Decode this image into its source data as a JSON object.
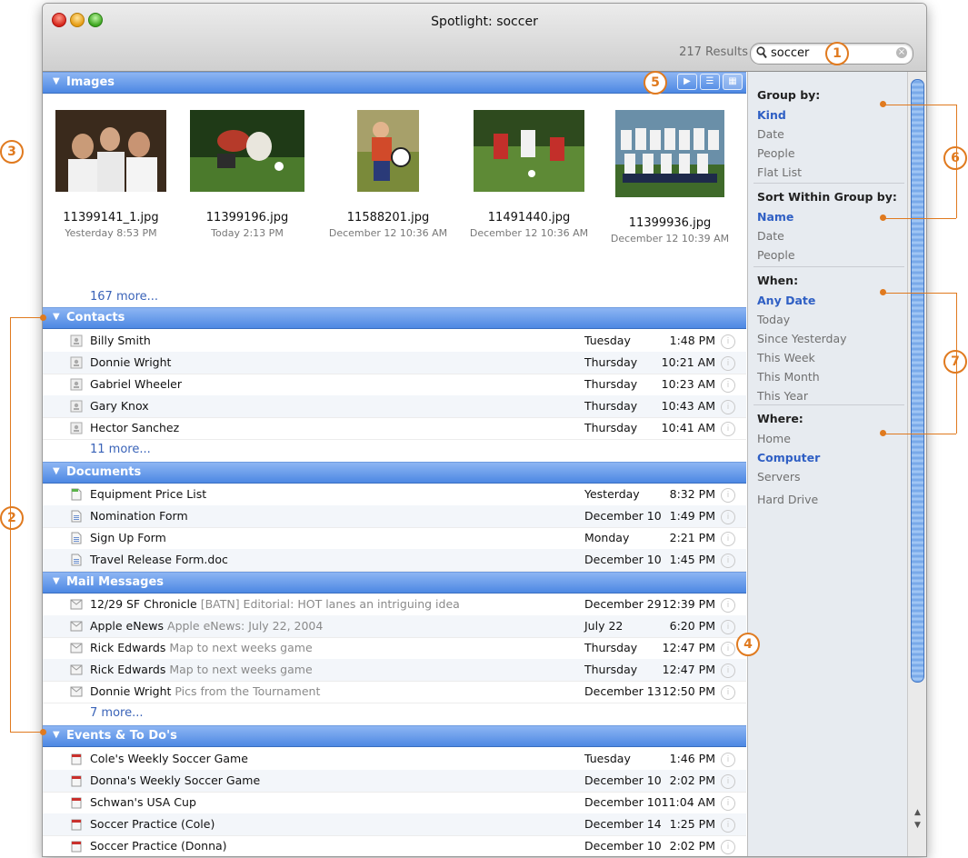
{
  "window": {
    "title": "Spotlight: soccer"
  },
  "search": {
    "results_count": "217 Results",
    "query": "soccer"
  },
  "sections": {
    "images": {
      "label": "Images",
      "items": [
        {
          "name": "11399141_1.jpg",
          "date": "Yesterday 8:53 PM"
        },
        {
          "name": "11399196.jpg",
          "date": "Today 2:13 PM"
        },
        {
          "name": "11588201.jpg",
          "date": "December 12 10:36 AM"
        },
        {
          "name": "11491440.jpg",
          "date": "December 12 10:36 AM"
        },
        {
          "name": "11399936.jpg",
          "date": "December 12 10:39 AM"
        }
      ],
      "more": "167 more..."
    },
    "contacts": {
      "label": "Contacts",
      "rows": [
        {
          "name": "Billy Smith",
          "date": "Tuesday",
          "time": "1:48 PM"
        },
        {
          "name": "Donnie Wright",
          "date": "Thursday",
          "time": "10:21 AM"
        },
        {
          "name": "Gabriel Wheeler",
          "date": "Thursday",
          "time": "10:23 AM"
        },
        {
          "name": "Gary Knox",
          "date": "Thursday",
          "time": "10:43 AM"
        },
        {
          "name": "Hector Sanchez",
          "date": "Thursday",
          "time": "10:41 AM"
        }
      ],
      "more": "11 more..."
    },
    "documents": {
      "label": "Documents",
      "rows": [
        {
          "name": "Equipment Price List",
          "date": "Yesterday",
          "time": "8:32 PM"
        },
        {
          "name": "Nomination Form",
          "date": "December 10",
          "time": "1:49 PM"
        },
        {
          "name": "Sign Up Form",
          "date": "Monday",
          "time": "2:21 PM"
        },
        {
          "name": "Travel Release Form.doc",
          "date": "December 10",
          "time": "1:45 PM"
        }
      ]
    },
    "mail": {
      "label": "Mail Messages",
      "rows": [
        {
          "name": "12/29 SF Chronicle",
          "subject": "[BATN] Editorial: HOT lanes an intriguing idea",
          "date": "December 29",
          "time": "12:39 PM"
        },
        {
          "name": "Apple eNews",
          "subject": "Apple eNews: July 22, 2004",
          "date": "July 22",
          "time": "6:20 PM"
        },
        {
          "name": "Rick Edwards",
          "subject": "Map to next weeks game",
          "date": "Thursday",
          "time": "12:47 PM"
        },
        {
          "name": "Rick Edwards",
          "subject": "Map to next weeks game",
          "date": "Thursday",
          "time": "12:47 PM"
        },
        {
          "name": "Donnie Wright",
          "subject": "Pics from the Tournament",
          "date": "December 13",
          "time": "12:50 PM"
        }
      ],
      "more": "7 more..."
    },
    "events": {
      "label": "Events & To Do's",
      "rows": [
        {
          "name": "Cole's Weekly Soccer Game",
          "date": "Tuesday",
          "time": "1:46 PM"
        },
        {
          "name": "Donna's Weekly Soccer Game",
          "date": "December 10",
          "time": "2:02 PM"
        },
        {
          "name": "Schwan's USA Cup",
          "date": "December 10",
          "time": "11:04 AM"
        },
        {
          "name": "Soccer Practice (Cole)",
          "date": "December 14",
          "time": "1:25 PM"
        },
        {
          "name": "Soccer Practice (Donna)",
          "date": "December 10",
          "time": "2:02 PM"
        }
      ]
    }
  },
  "sidebar": {
    "group_by": {
      "title": "Group by:",
      "items": [
        "Kind",
        "Date",
        "People",
        "Flat List"
      ],
      "selected": "Kind"
    },
    "sort_by": {
      "title": "Sort Within Group by:",
      "items": [
        "Name",
        "Date",
        "People"
      ],
      "selected": "Name"
    },
    "when": {
      "title": "When:",
      "items": [
        "Any Date",
        "Today",
        "Since Yesterday",
        "This Week",
        "This Month",
        "This Year"
      ],
      "selected": "Any Date"
    },
    "where": {
      "title": "Where:",
      "items": [
        "Home",
        "Computer",
        "Servers",
        "Hard Drive"
      ],
      "selected": "Computer"
    }
  },
  "callouts": [
    "1",
    "2",
    "3",
    "4",
    "5",
    "6",
    "7"
  ],
  "colors": {
    "header_blue": "#4d88e3",
    "accent_orange": "#e07a1f",
    "link_blue": "#2f5fc4"
  }
}
